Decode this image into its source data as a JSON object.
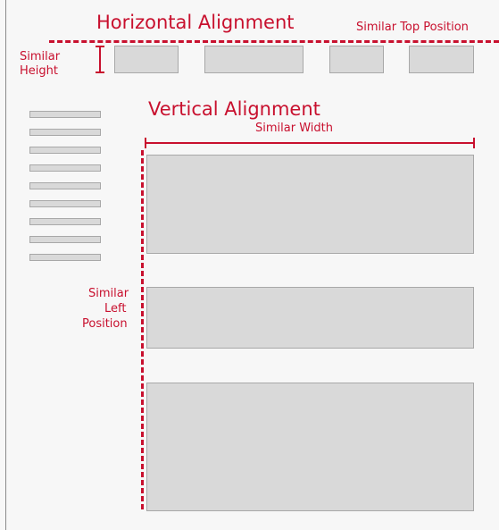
{
  "labels": {
    "horizontal_alignment": "Horizontal Alignment",
    "similar_top_position": "Similar Top Position",
    "similar_height_line1": "Similar",
    "similar_height_line2": "Height",
    "vertical_alignment": "Vertical Alignment",
    "similar_width": "Similar Width",
    "similar_left_line1": "Similar",
    "similar_left_line2": "Left",
    "similar_left_line3": "Position"
  },
  "colors": {
    "accent": "#c8102e",
    "block_fill": "#d9d9d9",
    "block_border": "#a8a8a8",
    "background": "#f7f7f7"
  }
}
